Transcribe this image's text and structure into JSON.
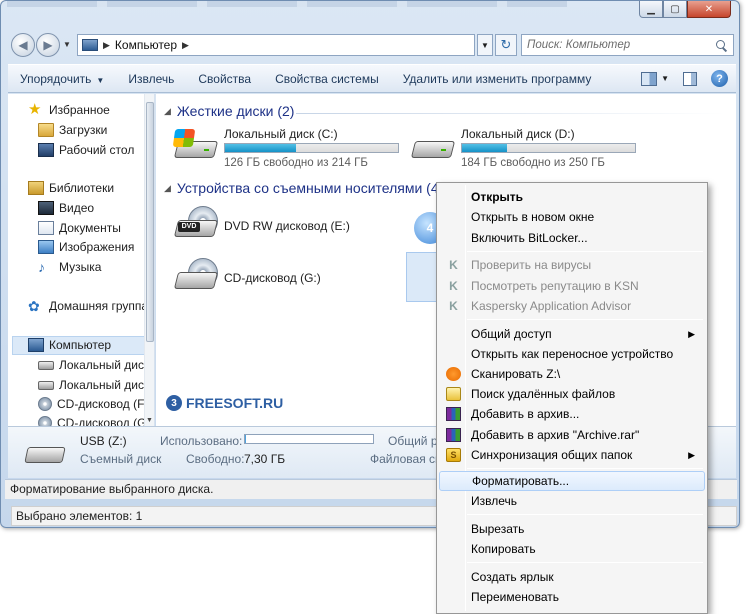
{
  "address": {
    "location": "Компьютер"
  },
  "search": {
    "placeholder": "Поиск: Компьютер"
  },
  "toolbar": {
    "organize": "Упорядочить",
    "eject": "Извлечь",
    "properties": "Свойства",
    "system_properties": "Свойства системы",
    "uninstall": "Удалить или изменить программу"
  },
  "sidebar": {
    "items": [
      {
        "label": "Избранное",
        "icon": "star-icon"
      },
      {
        "label": "Загрузки",
        "icon": "downloads-folder-icon"
      },
      {
        "label": "Рабочий стол",
        "icon": "desktop-icon"
      },
      {
        "label": "Библиотеки",
        "icon": "libraries-icon"
      },
      {
        "label": "Видео",
        "icon": "video-icon"
      },
      {
        "label": "Документы",
        "icon": "documents-icon"
      },
      {
        "label": "Изображения",
        "icon": "pictures-icon"
      },
      {
        "label": "Музыка",
        "icon": "music-icon"
      },
      {
        "label": "Домашняя группа",
        "icon": "homegroup-icon"
      },
      {
        "label": "Компьютер",
        "icon": "computer-icon"
      },
      {
        "label": "Локальный диск",
        "icon": "hdd-icon"
      },
      {
        "label": "Локальный диск",
        "icon": "hdd-icon"
      },
      {
        "label": "CD-дисковод (F:",
        "icon": "cd-icon"
      },
      {
        "label": "CD-дисковод (G:",
        "icon": "cd-icon"
      }
    ]
  },
  "groups": {
    "hard_disks": "Жесткие диски (2)",
    "removable": "Устройства со съемными носителями (4)"
  },
  "drives": {
    "c": {
      "name": "Локальный диск (C:)",
      "free": "126 ГБ свободно из 214 ГБ",
      "used_fraction": 0.41
    },
    "d": {
      "name": "Локальный диск (D:)",
      "free": "184 ГБ свободно из 250 ГБ",
      "used_fraction": 0.26
    },
    "e": {
      "name": "DVD RW дисковод (E:)",
      "badge": "DVD"
    },
    "g": {
      "name": "CD-дисковод (G:)"
    },
    "ksn_badge": "4"
  },
  "watermark": {
    "logo": "3",
    "text": "FREESOFT.RU"
  },
  "details": {
    "name": "USB (Z:)",
    "type": "Съемный диск",
    "used_label": "Использовано:",
    "used_fraction": 0.01,
    "free_label": "Свободно:",
    "free_value": "7,30 ГБ",
    "shared_label": "Общий ра",
    "fs_label": "Файловая сис"
  },
  "status": {
    "hint": "Форматирование выбранного диска.",
    "selected": "Выбрано элементов: 1"
  },
  "context_menu": {
    "items": [
      {
        "label": "Открыть"
      },
      {
        "label": "Открыть в новом окне"
      },
      {
        "label": "Включить BitLocker..."
      },
      {
        "label": "Проверить на вирусы"
      },
      {
        "label": "Посмотреть репутацию в KSN"
      },
      {
        "label": "Kaspersky Application Advisor"
      },
      {
        "label": "Общий доступ"
      },
      {
        "label": "Открыть как переносное устройство"
      },
      {
        "label": "Сканировать Z:\\"
      },
      {
        "label": "Поиск удалённых файлов"
      },
      {
        "label": "Добавить в архив..."
      },
      {
        "label": "Добавить в архив \"Archive.rar\""
      },
      {
        "label": "Синхронизация общих папок"
      },
      {
        "label": "Форматировать..."
      },
      {
        "label": "Извлечь"
      },
      {
        "label": "Вырезать"
      },
      {
        "label": "Копировать"
      },
      {
        "label": "Создать ярлык"
      },
      {
        "label": "Переименовать"
      }
    ]
  }
}
